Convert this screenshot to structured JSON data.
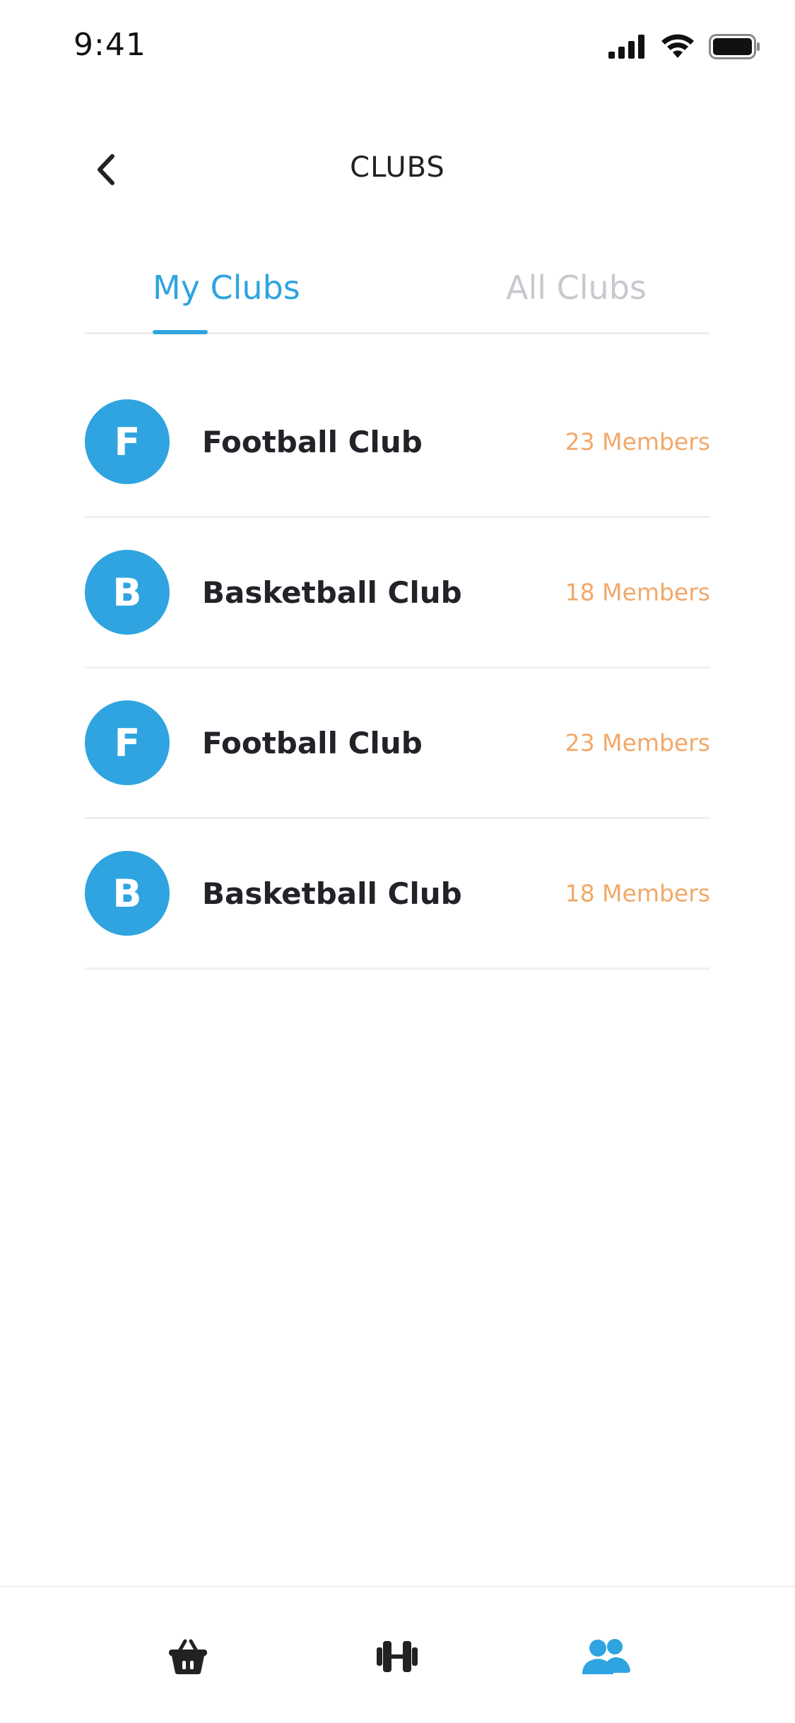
{
  "status_bar": {
    "time": "9:41",
    "icons": [
      "signal-icon",
      "wifi-icon",
      "battery-icon"
    ]
  },
  "header": {
    "title": "CLUBS",
    "back_icon": "chevron-left-icon"
  },
  "tabs": [
    {
      "label": "My Clubs",
      "active": true
    },
    {
      "label": "All Clubs",
      "active": false
    }
  ],
  "clubs": [
    {
      "initial": "F",
      "name": "Football Club",
      "members": "23 Members"
    },
    {
      "initial": "B",
      "name": "Basketball Club",
      "members": "18 Members"
    },
    {
      "initial": "F",
      "name": "Football Club",
      "members": "23 Members"
    },
    {
      "initial": "B",
      "name": "Basketball Club",
      "members": "18 Members"
    }
  ],
  "bottom_nav": [
    {
      "icon": "basket-icon",
      "active": false
    },
    {
      "icon": "dumbbell-icon",
      "active": false
    },
    {
      "icon": "users-icon",
      "active": true
    }
  ],
  "colors": {
    "accent": "#2fa4e0",
    "members_text": "#f2a868",
    "inactive_tab": "#c8c9cf",
    "dark_text": "#222228"
  }
}
